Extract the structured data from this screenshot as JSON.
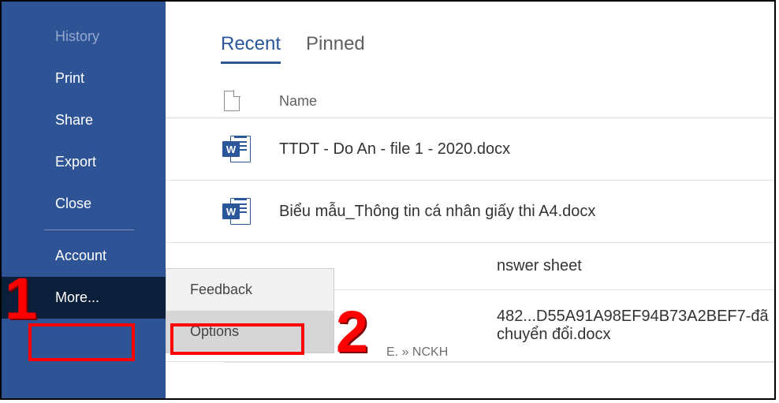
{
  "sidebar": {
    "items": [
      {
        "label": "History",
        "disabled": true
      },
      {
        "label": "Print"
      },
      {
        "label": "Share"
      },
      {
        "label": "Export"
      },
      {
        "label": "Close"
      },
      {
        "label": "Account"
      },
      {
        "label": "More..."
      }
    ]
  },
  "tabs": {
    "recent": "Recent",
    "pinned": "Pinned"
  },
  "list": {
    "name_header": "Name",
    "rows": [
      {
        "fname": "TTDT - Do An - file 1 - 2020.docx"
      },
      {
        "fname": "Biểu mẫu_Thông tin cá nhân giấy thi A4.docx"
      },
      {
        "fname_fragment": "nswer sheet"
      },
      {
        "fname_fragment_right": "482...D55A91A98EF94B73A2BEF7-đã chuyển đổi.docx",
        "sub_frag": "E. » NCKH"
      }
    ]
  },
  "popup": {
    "feedback": "Feedback",
    "options": "Options"
  },
  "annotations": {
    "n1": "1",
    "n2": "2"
  }
}
